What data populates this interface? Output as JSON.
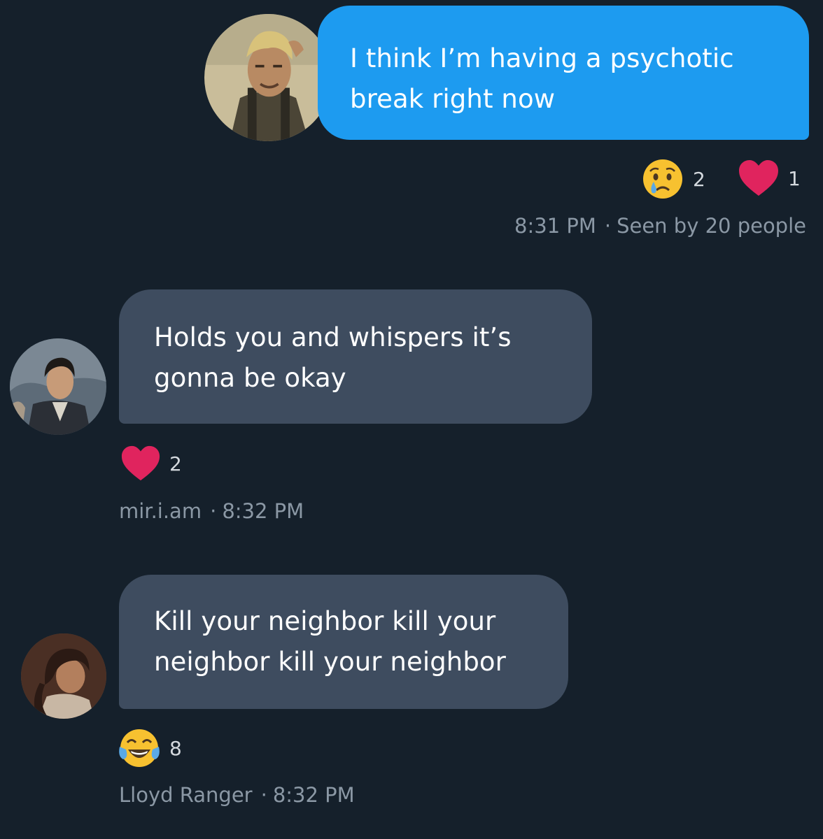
{
  "colors": {
    "background": "#15202b",
    "outgoing_bubble": "#1d9bf0",
    "incoming_bubble": "#3e4c5f",
    "meta_text": "#8b98a5",
    "heart": "#e0245e"
  },
  "messages": [
    {
      "direction": "outgoing",
      "text": "I think I’m having a psychotic break right now",
      "reactions": [
        {
          "icon": "crying-face-icon",
          "count": "2"
        },
        {
          "icon": "heart-icon",
          "count": "1"
        }
      ],
      "time": "8:31 PM",
      "seen": "Seen by 20 people"
    },
    {
      "direction": "incoming",
      "text": "Holds you and whispers it’s gonna be okay",
      "reactions": [
        {
          "icon": "heart-icon",
          "count": "2"
        }
      ],
      "sender": "mir.i.am",
      "time": "8:32 PM"
    },
    {
      "direction": "incoming",
      "text": "Kill your neighbor kill your neighbor kill your neighbor",
      "reactions": [
        {
          "icon": "tears-of-joy-icon",
          "count": "8"
        }
      ],
      "sender": "Lloyd Ranger",
      "time": "8:32 PM"
    }
  ],
  "separator": "·"
}
